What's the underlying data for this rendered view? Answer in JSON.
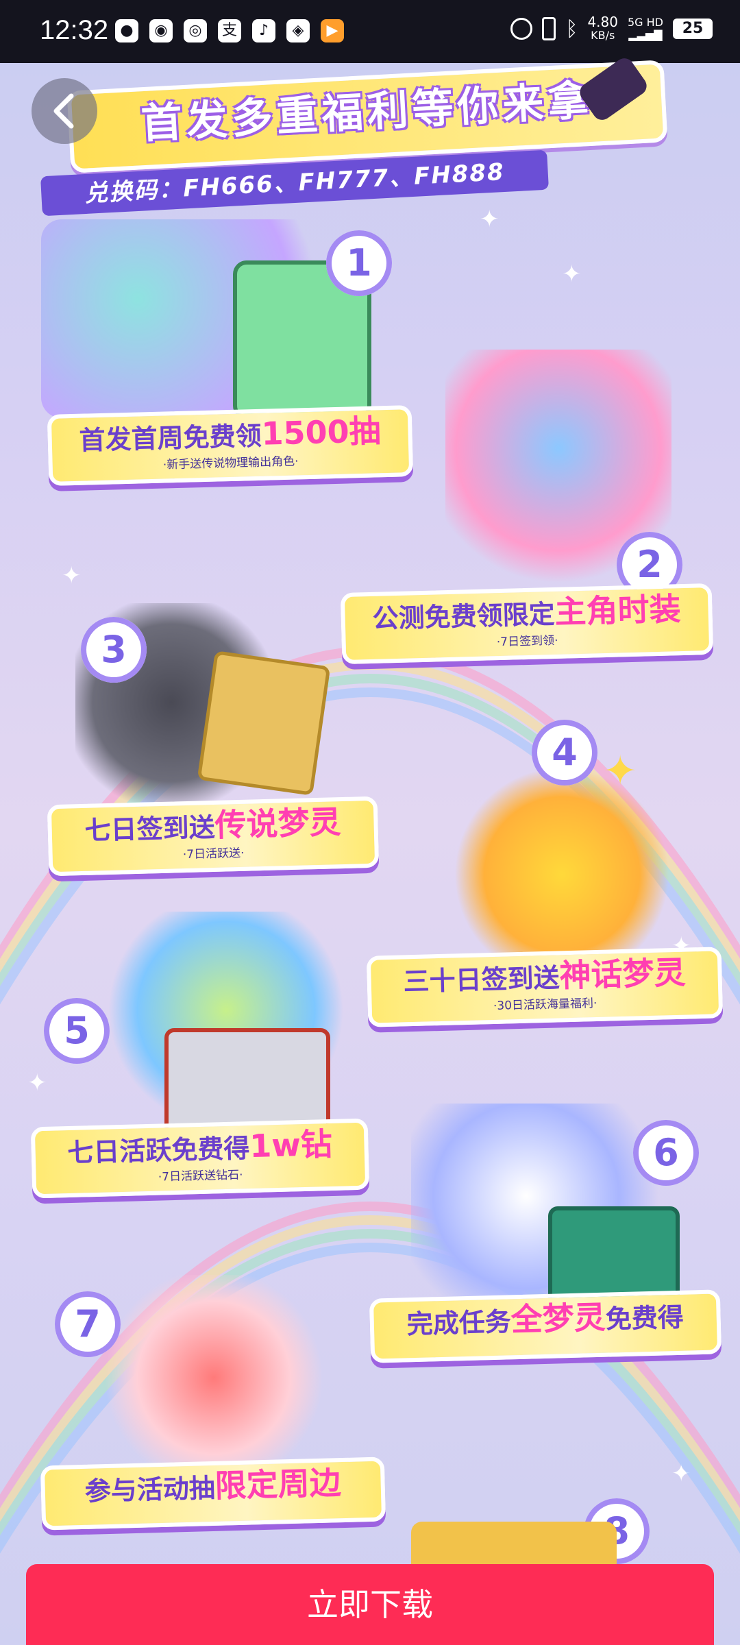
{
  "status_bar": {
    "time": "12:32",
    "speed": "4.80",
    "speed_unit": "KB/s",
    "network": "5G HD",
    "battery": "25",
    "apps": [
      "wechat-icon",
      "message-icon",
      "camera-icon",
      "alipay-icon",
      "tiktok-icon",
      "app-icon",
      "video-icon"
    ]
  },
  "hero": {
    "title": "首发多重福利等你来拿",
    "codes": "兑换码：FH666、FH777、FH888"
  },
  "perks": [
    {
      "num": "1",
      "title": "首发首周免费领",
      "highlight": "1500抽",
      "tail": "",
      "sub": "·新手送传说物理输出角色·"
    },
    {
      "num": "2",
      "title": "公测免费领限定",
      "highlight": "主角时装",
      "tail": "",
      "sub": "·7日签到领·"
    },
    {
      "num": "3",
      "title": "七日签到送",
      "highlight": "传说梦灵",
      "tail": "",
      "sub": "·7日活跃送·"
    },
    {
      "num": "4",
      "title": "三十日签到送",
      "highlight": "神话梦灵",
      "tail": "",
      "sub": "·30日活跃海量福利·"
    },
    {
      "num": "5",
      "title": "七日活跃免费得",
      "highlight": "1w钻",
      "tail": "",
      "sub": "·7日活跃送钻石·"
    },
    {
      "num": "6",
      "title": "完成任务",
      "highlight": "全梦灵",
      "tail": "免费得",
      "sub": ""
    },
    {
      "num": "7",
      "title": "参与活动抽",
      "highlight": "限定周边",
      "tail": "",
      "sub": ""
    },
    {
      "num": "8",
      "title": "",
      "highlight": "",
      "tail": "",
      "sub": ""
    }
  ],
  "download_button": "立即下载",
  "colors": {
    "accent": "#fe2c55",
    "banner": "#ffea72",
    "highlight": "#ff3fb2",
    "purple": "#6a3fcc"
  }
}
